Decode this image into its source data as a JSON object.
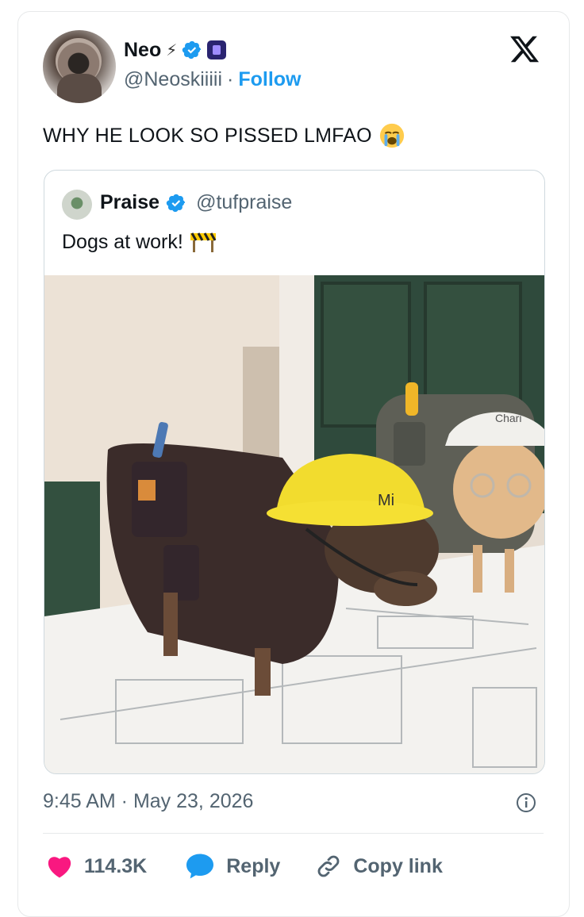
{
  "tweet": {
    "author": {
      "name": "Neo",
      "handle": "@Neoskiiiii",
      "name_glyph": "⚡︎",
      "follow_label": "Follow",
      "separator": "·"
    },
    "text": "WHY HE LOOK SO PISSED LMFAO",
    "timestamp": "9:45 AM · May 23, 2026",
    "likes": "114.3K",
    "reply_label": "Reply",
    "copy_link_label": "Copy link"
  },
  "quote": {
    "name": "Praise",
    "handle": "@tufpraise",
    "text": "Dogs at work!",
    "image_texts": {
      "helmet_left": "Mi",
      "helmet_right": "Chari"
    }
  },
  "icons": {
    "verified": "verified-badge-icon",
    "x_logo": "x-logo-icon",
    "emoji_crying": "loudly-crying-face-emoji",
    "emoji_construction": "construction-barrier-emoji",
    "info": "info-icon",
    "heart": "heart-icon",
    "reply": "speech-bubble-icon",
    "link": "link-icon"
  },
  "colors": {
    "accent": "#1d9bf0",
    "heart": "#f91880",
    "muted": "#536471",
    "text": "#0f1419",
    "border": "#cfd9de"
  }
}
